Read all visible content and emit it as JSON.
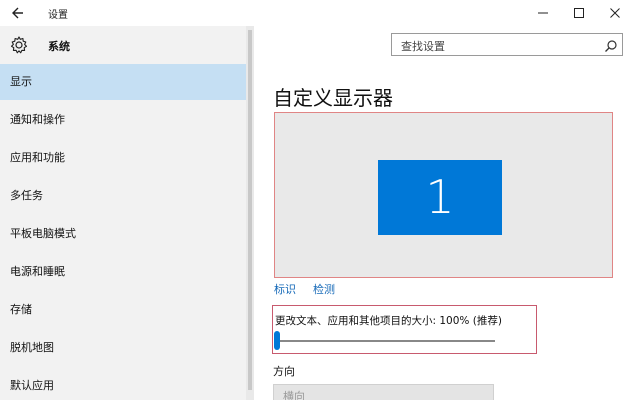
{
  "window": {
    "title": "设置",
    "back_icon": "back-arrow-icon",
    "minimize_icon": "minimize-icon",
    "maximize_icon": "maximize-icon",
    "close_icon": "close-icon"
  },
  "sidebar": {
    "header_icon": "gear-icon",
    "header_label": "系统",
    "items": [
      {
        "label": "显示",
        "active": true
      },
      {
        "label": "通知和操作",
        "active": false
      },
      {
        "label": "应用和功能",
        "active": false
      },
      {
        "label": "多任务",
        "active": false
      },
      {
        "label": "平板电脑模式",
        "active": false
      },
      {
        "label": "电源和睡眠",
        "active": false
      },
      {
        "label": "存储",
        "active": false
      },
      {
        "label": "脱机地图",
        "active": false
      },
      {
        "label": "默认应用",
        "active": false
      }
    ]
  },
  "search": {
    "placeholder": "查找设置",
    "icon": "search-icon"
  },
  "main": {
    "title": "自定义显示器",
    "monitor_number": "1",
    "identify_link": "标识",
    "detect_link": "检测",
    "scale_label": "更改文本、应用和其他项目的大小: 100% (推荐)",
    "scale_percent": 100,
    "orientation_label": "方向",
    "orientation_value": "横向"
  },
  "colors": {
    "accent": "#0078d7",
    "sidebar_bg": "#f2f2f2",
    "active_item_bg": "#c5dff3",
    "link": "#1569b8",
    "highlight_border": "#c85a6e"
  }
}
